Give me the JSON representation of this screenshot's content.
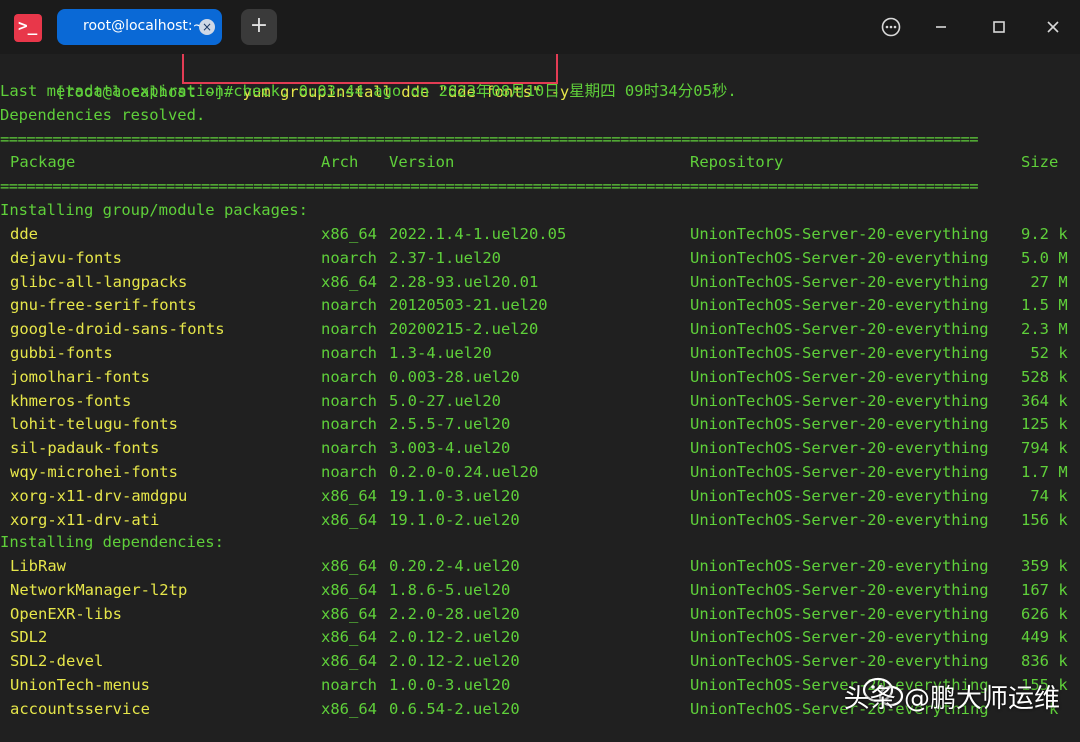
{
  "titlebar": {
    "tab_title": "root@localhost:~",
    "close_glyph": "×",
    "new_tab_glyph": "+",
    "icons": [
      "terminal-logo-icon",
      "more-options-icon",
      "minimize-icon",
      "maximize-icon",
      "close-window-icon"
    ],
    "accent": "#0a69d6"
  },
  "terminal": {
    "prompt": "[root@localhost ~]# ",
    "command": "yum groupinstall dde \"dde fonts\" -y",
    "meta": "Last metadata expiration check: 0:03:44 ago on 2023年08月10日 星期四 09时34分05秒.",
    "deps_resolved": "Dependencies resolved.",
    "rule": "================================================================================================================",
    "headers": {
      "package": "Package",
      "arch": "Arch",
      "version": "Version",
      "repository": "Repository",
      "size": "Size"
    },
    "section1": "Installing group/module packages:",
    "section2": "Installing dependencies:",
    "group_packages": [
      {
        "name": "dde",
        "arch": "x86_64",
        "version": "2022.1.4-1.uel20.05",
        "repo": "UnionTechOS-Server-20-everything",
        "size": "9.2 k"
      },
      {
        "name": "dejavu-fonts",
        "arch": "noarch",
        "version": "2.37-1.uel20",
        "repo": "UnionTechOS-Server-20-everything",
        "size": "5.0 M"
      },
      {
        "name": "glibc-all-langpacks",
        "arch": "x86_64",
        "version": "2.28-93.uel20.01",
        "repo": "UnionTechOS-Server-20-everything",
        "size": " 27 M"
      },
      {
        "name": "gnu-free-serif-fonts",
        "arch": "noarch",
        "version": "20120503-21.uel20",
        "repo": "UnionTechOS-Server-20-everything",
        "size": "1.5 M"
      },
      {
        "name": "google-droid-sans-fonts",
        "arch": "noarch",
        "version": "20200215-2.uel20",
        "repo": "UnionTechOS-Server-20-everything",
        "size": "2.3 M"
      },
      {
        "name": "gubbi-fonts",
        "arch": "noarch",
        "version": "1.3-4.uel20",
        "repo": "UnionTechOS-Server-20-everything",
        "size": " 52 k"
      },
      {
        "name": "jomolhari-fonts",
        "arch": "noarch",
        "version": "0.003-28.uel20",
        "repo": "UnionTechOS-Server-20-everything",
        "size": "528 k"
      },
      {
        "name": "khmeros-fonts",
        "arch": "noarch",
        "version": "5.0-27.uel20",
        "repo": "UnionTechOS-Server-20-everything",
        "size": "364 k"
      },
      {
        "name": "lohit-telugu-fonts",
        "arch": "noarch",
        "version": "2.5.5-7.uel20",
        "repo": "UnionTechOS-Server-20-everything",
        "size": "125 k"
      },
      {
        "name": "sil-padauk-fonts",
        "arch": "noarch",
        "version": "3.003-4.uel20",
        "repo": "UnionTechOS-Server-20-everything",
        "size": "794 k"
      },
      {
        "name": "wqy-microhei-fonts",
        "arch": "noarch",
        "version": "0.2.0-0.24.uel20",
        "repo": "UnionTechOS-Server-20-everything",
        "size": "1.7 M"
      },
      {
        "name": "xorg-x11-drv-amdgpu",
        "arch": "x86_64",
        "version": "19.1.0-3.uel20",
        "repo": "UnionTechOS-Server-20-everything",
        "size": " 74 k"
      },
      {
        "name": "xorg-x11-drv-ati",
        "arch": "x86_64",
        "version": "19.1.0-2.uel20",
        "repo": "UnionTechOS-Server-20-everything",
        "size": "156 k"
      }
    ],
    "dependencies": [
      {
        "name": "LibRaw",
        "arch": "x86_64",
        "version": "0.20.2-4.uel20",
        "repo": "UnionTechOS-Server-20-everything",
        "size": "359 k"
      },
      {
        "name": "NetworkManager-l2tp",
        "arch": "x86_64",
        "version": "1.8.6-5.uel20",
        "repo": "UnionTechOS-Server-20-everything",
        "size": "167 k"
      },
      {
        "name": "OpenEXR-libs",
        "arch": "x86_64",
        "version": "2.2.0-28.uel20",
        "repo": "UnionTechOS-Server-20-everything",
        "size": "626 k"
      },
      {
        "name": "SDL2",
        "arch": "x86_64",
        "version": "2.0.12-2.uel20",
        "repo": "UnionTechOS-Server-20-everything",
        "size": "449 k"
      },
      {
        "name": "SDL2-devel",
        "arch": "x86_64",
        "version": "2.0.12-2.uel20",
        "repo": "UnionTechOS-Server-20-everything",
        "size": "836 k"
      },
      {
        "name": "UnionTech-menus",
        "arch": "noarch",
        "version": "1.0.0-3.uel20",
        "repo": "UnionTechOS-Server-20-everything",
        "size": "155 k"
      },
      {
        "name": "accountsservice",
        "arch": "x86_64",
        "version": "0.6.54-2.uel20",
        "repo": "UnionTechOS-Server-20-everything",
        "size": "   k"
      }
    ],
    "colors": {
      "green": "#5fd03a",
      "yellow": "#e6e64a",
      "highlight": "#e33c54",
      "background": "#202020"
    }
  },
  "watermark": {
    "text": "头条 @鹏大师运维",
    "icon": "wechat-icon"
  }
}
